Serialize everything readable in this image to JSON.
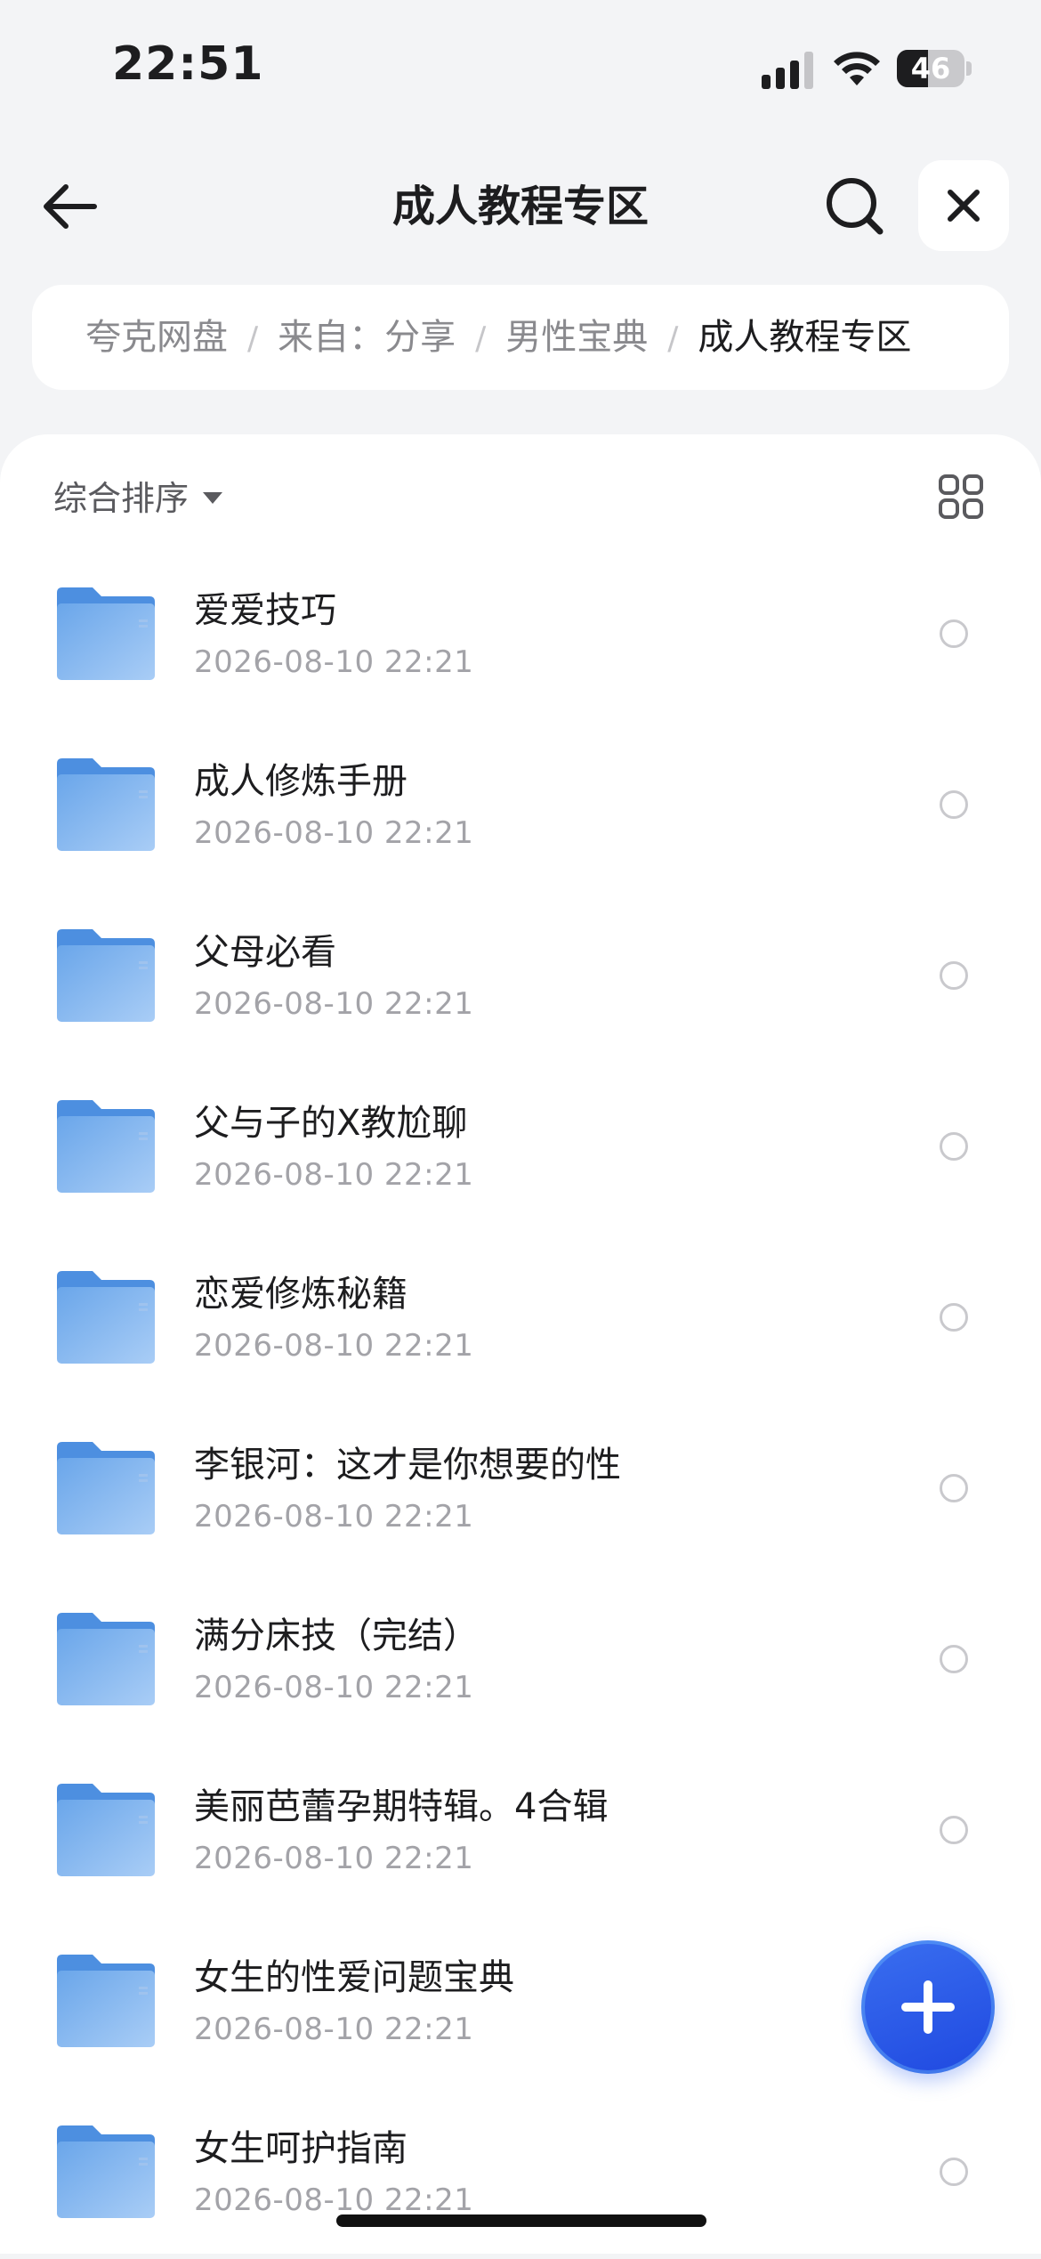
{
  "status_bar": {
    "time": "22:51",
    "battery": "46",
    "battery_level": 0.46,
    "icons": [
      "signal-icon",
      "wifi-icon",
      "battery-icon"
    ]
  },
  "nav": {
    "title": "成人教程专区",
    "icons": [
      "back-arrow-icon",
      "search-icon",
      "close-icon"
    ]
  },
  "breadcrumb": [
    {
      "label": "夸克网盘"
    },
    {
      "label": "来自：分享"
    },
    {
      "label": "男性宝典"
    },
    {
      "label": "成人教程专区",
      "current": true
    }
  ],
  "breadcrumb_separator": "/",
  "toolbar": {
    "sort_label": "综合排序",
    "view_icon": "grid-view-icon"
  },
  "files": [
    {
      "name": "爱爱技巧",
      "time": "2026-08-10 22:21",
      "icon": "folder-icon"
    },
    {
      "name": "成人修炼手册",
      "time": "2026-08-10 22:21",
      "icon": "folder-icon"
    },
    {
      "name": "父母必看",
      "time": "2026-08-10 22:21",
      "icon": "folder-icon"
    },
    {
      "name": "父与子的X教尬聊",
      "time": "2026-08-10 22:21",
      "icon": "folder-icon"
    },
    {
      "name": "恋爱修炼秘籍",
      "time": "2026-08-10 22:21",
      "icon": "folder-icon"
    },
    {
      "name": "李银河：这才是你想要的性",
      "time": "2026-08-10 22:21",
      "icon": "folder-icon"
    },
    {
      "name": "满分床技（完结）",
      "time": "2026-08-10 22:21",
      "icon": "folder-icon"
    },
    {
      "name": "美丽芭蕾孕期特辑。4合辑",
      "time": "2026-08-10 22:21",
      "icon": "folder-icon"
    },
    {
      "name": "女生的性爱问题宝典",
      "time": "2026-08-10 22:21",
      "icon": "folder-icon"
    },
    {
      "name": "女生呵护指南",
      "time": "2026-08-10 22:21",
      "icon": "folder-icon"
    }
  ],
  "fab_icon": "plus-icon",
  "colors": {
    "accent": "#2f5ff0",
    "folder": "#7fb4ee",
    "background": "#f3f4f6"
  }
}
